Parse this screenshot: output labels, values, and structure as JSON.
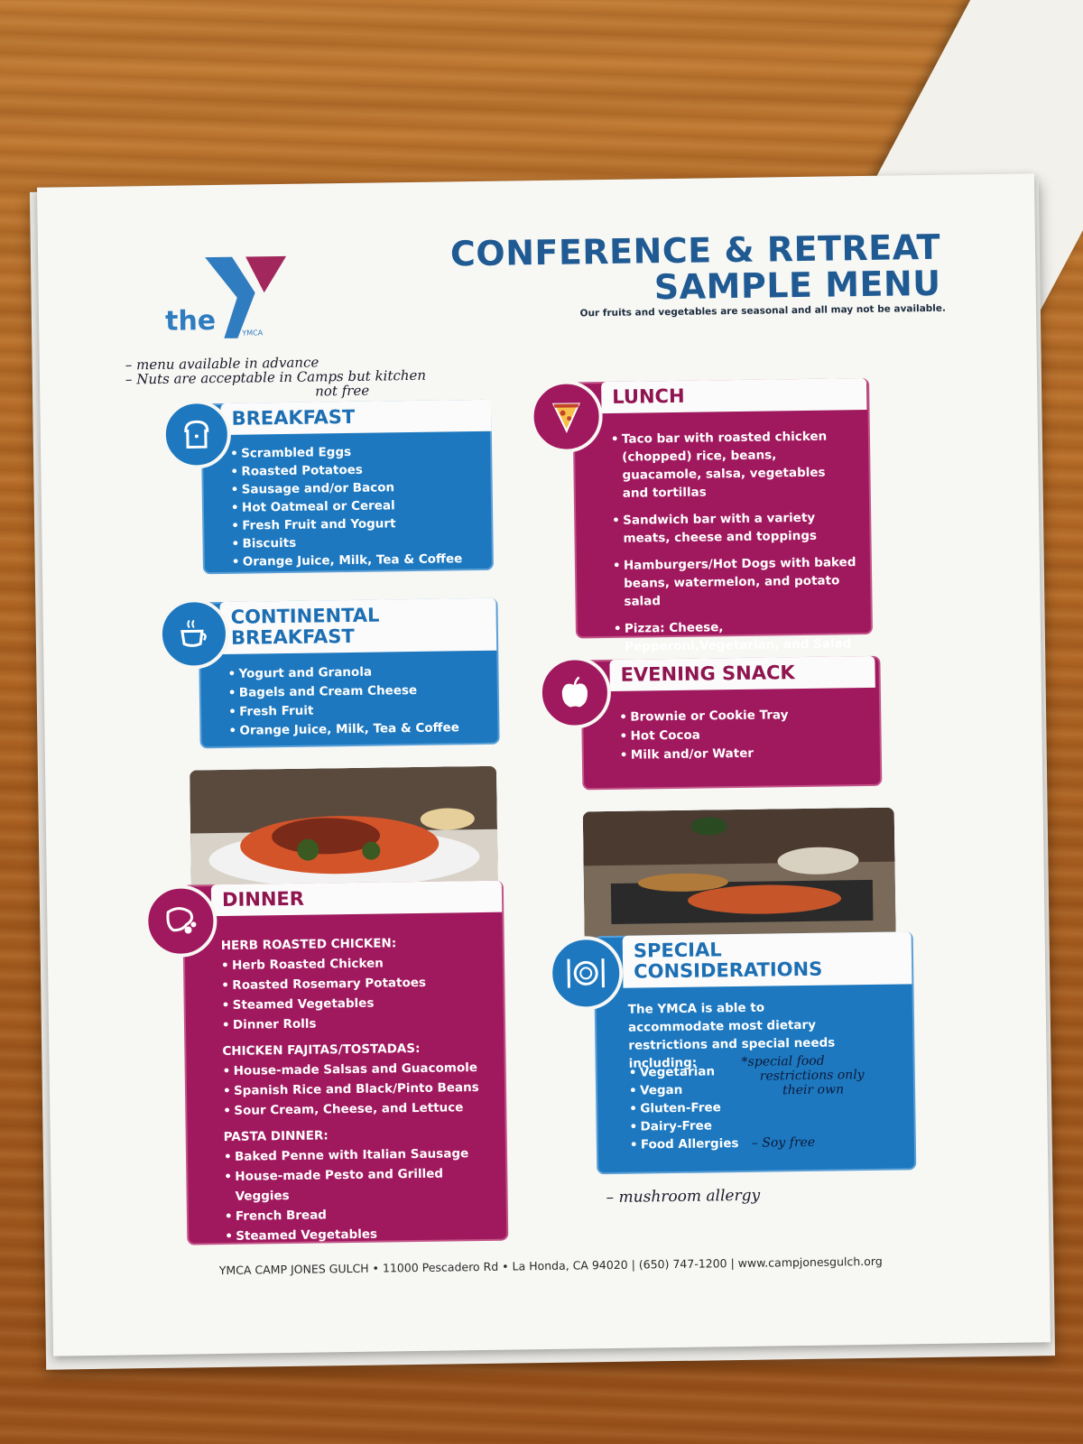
{
  "header": {
    "logo_text": "the",
    "logo_brand": "YMCA",
    "title_line1": "CONFERENCE & RETREAT",
    "title_line2": "SAMPLE MENU",
    "note": "Our fruits and vegetables are seasonal and all may not be available."
  },
  "handwritten": {
    "top_line1": "– menu available in advance",
    "top_line2": "– Nuts are acceptable in Camps but kitchen",
    "top_line3": "not free",
    "special_note1": "*special food",
    "special_note2": "restrictions only",
    "special_note3": "their own",
    "special_note4": "– Soy free",
    "bottom_note": "– mushroom allergy"
  },
  "breakfast": {
    "title": "BREAKFAST",
    "items": [
      "Scrambled Eggs",
      "Roasted Potatoes",
      "Sausage and/or Bacon",
      "Hot Oatmeal or Cereal",
      "Fresh Fruit and Yogurt",
      "Biscuits",
      "Orange Juice, Milk, Tea & Coffee"
    ]
  },
  "continental": {
    "title_line1": "CONTINENTAL",
    "title_line2": "BREAKFAST",
    "items": [
      "Yogurt and Granola",
      "Bagels and Cream Cheese",
      "Fresh Fruit",
      "Orange Juice, Milk, Tea & Coffee"
    ]
  },
  "lunch": {
    "title": "LUNCH",
    "items": [
      "Taco bar with roasted chicken (chopped) rice, beans, guacamole, salsa, vegetables and tortillas",
      "Sandwich bar with a variety meats, cheese and toppings",
      "Hamburgers/Hot Dogs with baked beans, watermelon, and potato salad",
      "Pizza: Cheese, Pepperoni,Vegetarian, and Salad Bar"
    ]
  },
  "snack": {
    "title": "EVENING SNACK",
    "items": [
      "Brownie or Cookie Tray",
      "Hot Cocoa",
      "Milk and/or Water"
    ]
  },
  "dinner": {
    "title": "DINNER",
    "sections": [
      {
        "heading": "HERB ROASTED CHICKEN:",
        "items": [
          "Herb Roasted Chicken",
          "Roasted Rosemary Potatoes",
          "Steamed Vegetables",
          "Dinner Rolls"
        ]
      },
      {
        "heading": "CHICKEN FAJITAS/TOSTADAS:",
        "items": [
          "House-made Salsas and Guacomole",
          "Spanish Rice and Black/Pinto Beans",
          "Sour Cream, Cheese, and Lettuce"
        ]
      },
      {
        "heading": "PASTA DINNER:",
        "items": [
          "Baked Penne with Italian Sausage",
          "House-made Pesto and Grilled Veggies",
          "French Bread",
          "Steamed Vegetables"
        ]
      }
    ]
  },
  "special": {
    "title_line1": "SPECIAL",
    "title_line2": "CONSIDERATIONS",
    "intro": "The YMCA is able to accommodate most dietary restrictions and special needs including:",
    "items": [
      "Vegetarian",
      "Vegan",
      "Gluten-Free",
      "Dairy-Free",
      "Food Allergies"
    ]
  },
  "footer": "YMCA CAMP JONES GULCH • 11000 Pescadero Rd • La Honda, CA 94020 | (650) 747-1200 | www.campjonesgulch.org",
  "colors": {
    "blue": "#1d78bf",
    "plum": "#a0195e",
    "title_blue": "#1f5a93"
  }
}
